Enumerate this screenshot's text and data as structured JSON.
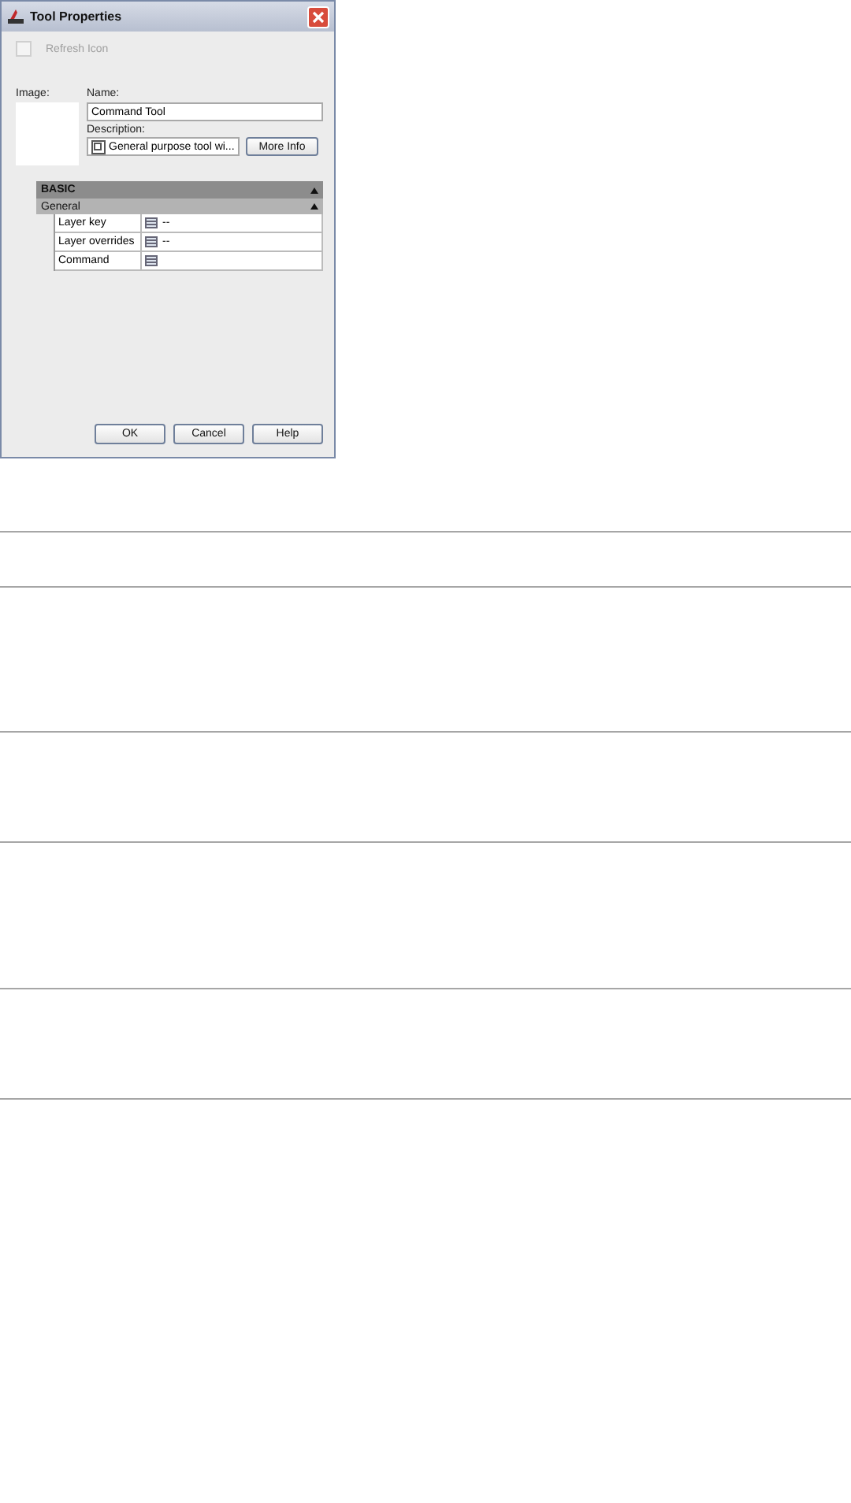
{
  "window": {
    "title": "Tool Properties"
  },
  "refresh_icon": {
    "label": "Refresh Icon",
    "checked": false,
    "disabled": true
  },
  "image": {
    "label": "Image:"
  },
  "name": {
    "label": "Name:",
    "value": "Command Tool"
  },
  "description": {
    "label": "Description:",
    "value": "General purpose tool wi..."
  },
  "more_info": "More Info",
  "sections": [
    {
      "title": "BASIC",
      "expanded": true,
      "groups": [
        {
          "title": "General",
          "expanded": true,
          "properties": [
            {
              "name": "Layer key",
              "value": "--"
            },
            {
              "name": "Layer overrides",
              "value": "--"
            },
            {
              "name": "Command"
            }
          ]
        }
      ]
    }
  ],
  "buttons": [
    "OK",
    "Cancel",
    "Help"
  ]
}
